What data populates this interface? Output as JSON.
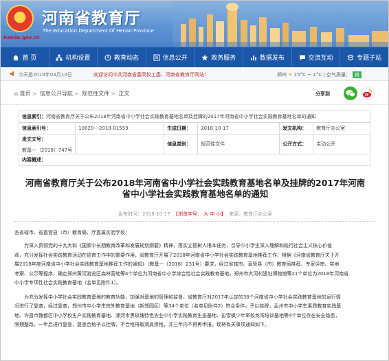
{
  "header": {
    "title": "河南省教育厅",
    "subtitle": "The Education Department Of Henan Province",
    "url": "haedu.gov.cn"
  },
  "nav": [
    {
      "label": "首  页",
      "icon": "home-icon"
    },
    {
      "label": "机构设置",
      "icon": "org-icon"
    },
    {
      "label": "教育动态",
      "icon": "news-icon"
    },
    {
      "label": "信息公开",
      "icon": "info-icon"
    },
    {
      "label": "政务服务",
      "icon": "service-icon"
    },
    {
      "label": "数据发布",
      "icon": "data-icon"
    },
    {
      "label": "交流互动",
      "icon": "chat-icon"
    },
    {
      "label": "专题子站",
      "icon": "topic-icon"
    }
  ],
  "infobar": {
    "date": "今天是2019年03月13日",
    "marquee": "欢迎访问中共河南省委高校工委、河南省教育厅网站！",
    "weather": "郑州",
    "temp": "15°C ~ 1°C",
    "air_label": "空气质量：",
    "air_value": "良"
  },
  "breadcrumb": {
    "items": [
      "首页",
      "信息公开导航",
      "规范性文件",
      "正文"
    ],
    "share_label": "分享到"
  },
  "meta": {
    "index_label": "信息索引：",
    "index_value": "河南省教育厅关于公布2018年河南省中小学社会实践教育基地名单及挂牌的2017年河南省中小学社会实践教育基地名单的通知",
    "doc_label": "信息索引号：",
    "doc_value": "10020---2018-01559",
    "date_label": "生成日期：",
    "date_value": "2018-10-17",
    "issuer_label": "发文机构：",
    "issuer_value": "教育厅办公室",
    "num_label": "发文文号：",
    "num_value": "教基一〔2018〕747号",
    "cat_label": "信息类别：",
    "cat_value": "规范性文件",
    "open_label": "公开方式：",
    "open_value": "主动公开",
    "summary_label": "内容概述："
  },
  "article": {
    "title_line1": "河南省教育厅关于公布2018年河南省中小学社会实践教育基地名单及挂牌的2017年河南",
    "title_line2": "省中小学社会实践教育基地名单的通知",
    "date_prefix": "发布时间：",
    "date": "2018-10-17",
    "font_label": "【浏览字号： 大  中  小】",
    "source": "来源：教育厅办公室",
    "salutation": "各省辖市、省直管县（市）教育局、厅直属实验学校：",
    "para1": [
      "为深入贯彻党的十九大和《国家中长期教育改革和发展规划纲要》精神，落实立德树人根本任务，引导中小学生深入理解和践行社会主义核心价值",
      "观，充分发挥社会实践教育活动在德育工作中的重要作用，省教育厅开展了2018年河南省中小学社会实践教育基地推荐工作，根据《河南省教育厅关于开",
      "展2018年度河南省中小学社会实践教育基地推荐工作的通知》（教基一〔2018〕231号）要求，经过省辖市、直管县（市）教育局推荐、专家评审、实地",
      "考察、公示等程序，确定郑州黄河游览区森林营地等4个单位为河南省中小学综合性社会实践教育基地，郑州市大河村遗址博物馆等21个单位为2018年河南省",
      "中小学专项性社会实践教育基地（名单见附件1）。"
    ],
    "para2": [
      "为充分发挥中小学社会实践教育基地的教育功能，加强对基地的管理和监督，省教育厅对2017年认定的38个河南省中小学社会实践教育基地的运行情",
      "况进行了复查，经过复查，郑州市中小学生校外教育基地（新郑园区）等34个单位（名单见附件2）符合条件，予以挂牌，孟州市中小学生素质教育实践基",
      "地、许昌市魏都区中小学校生产实践教育基地、漯河市黑玫瑰特色农业中小学实践教育生态基地、彭雪枫少年军校龙湾培训基地等4个单位存在安全隐患，",
      "限期整改，一年后进行复查，复查合格予以挂牌，不合格将取消其资格，并三年内不得再申报。现将有关事项通知如下。"
    ]
  }
}
